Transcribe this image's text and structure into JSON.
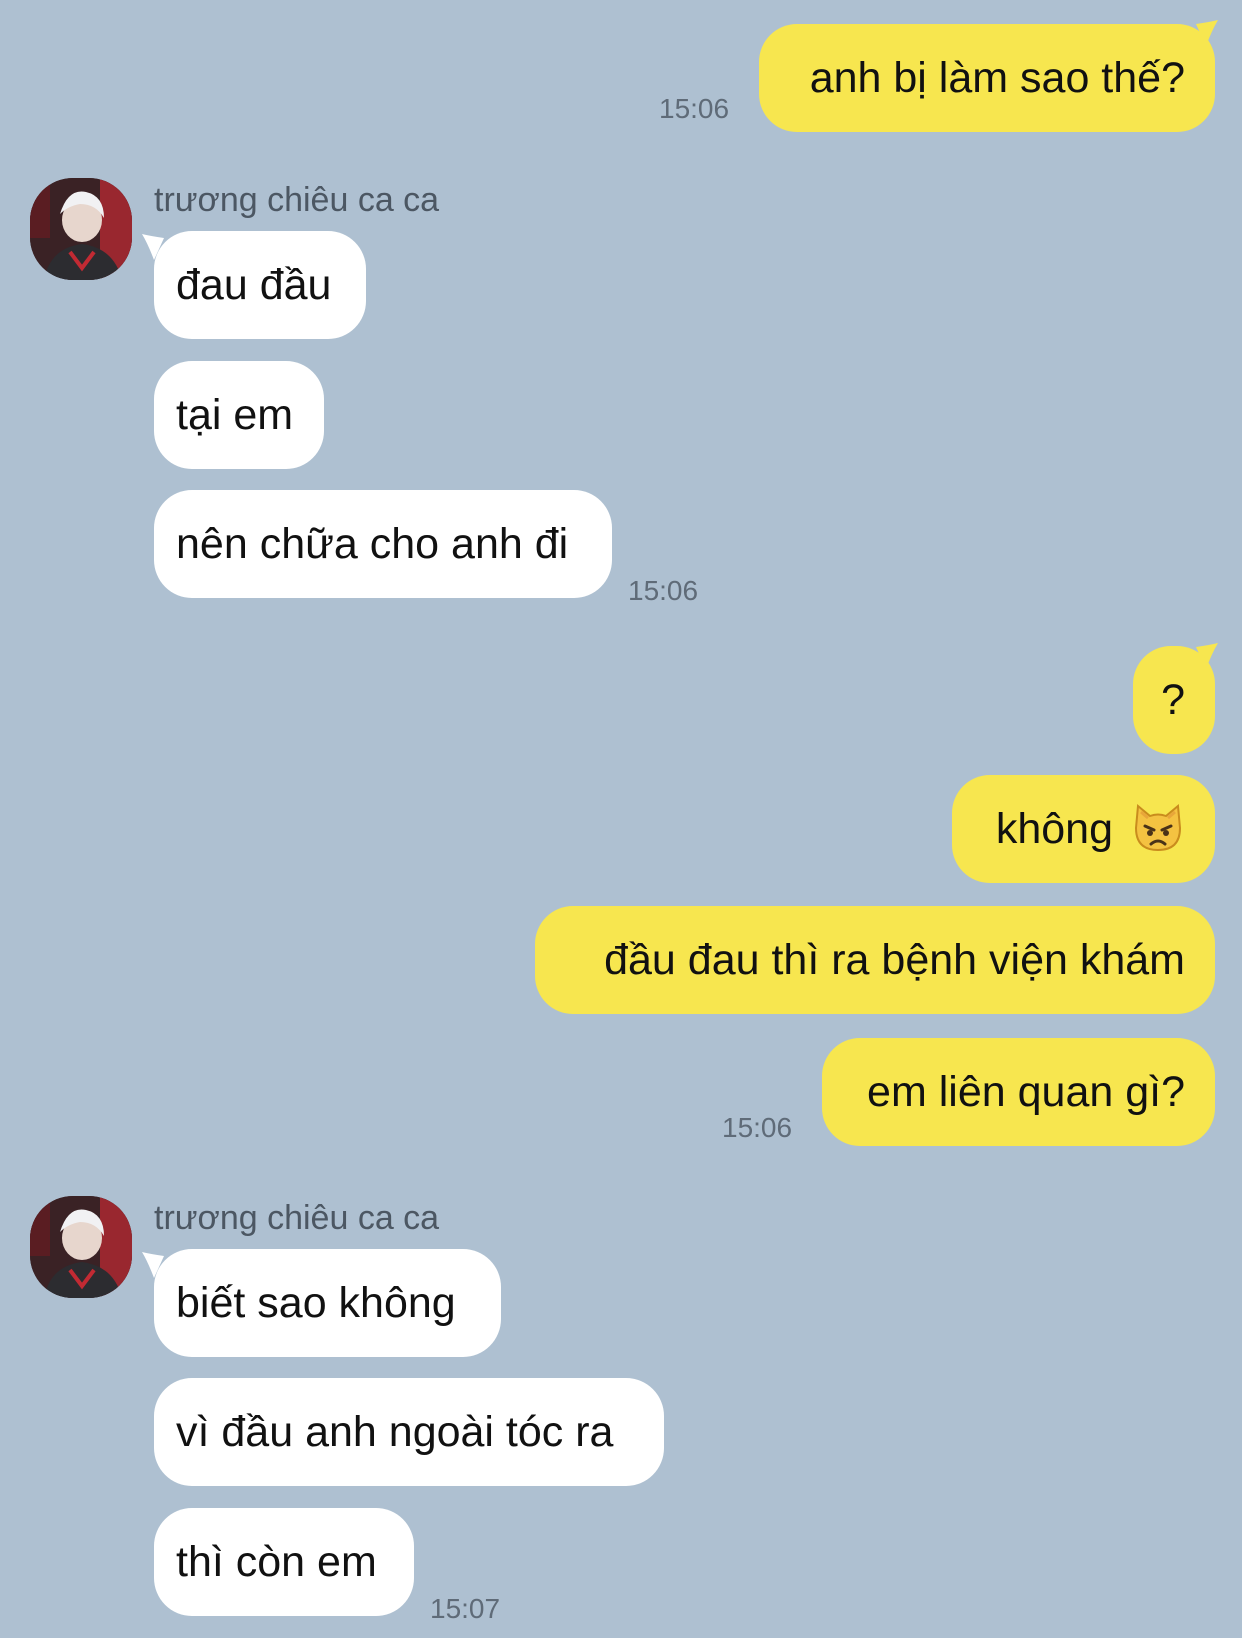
{
  "chat": {
    "sender_name": "trương chiêu ca ca",
    "avatar_icon": "avatar-photo",
    "colors": {
      "background": "#aec0d1",
      "incoming_bubble": "#ffffff",
      "outgoing_bubble": "#f7e64f"
    },
    "messages": [
      {
        "text": "anh bị làm sao thế?"
      },
      {
        "text": "đau đầu"
      },
      {
        "text": "tại em"
      },
      {
        "text": "nên chữa cho anh đi"
      },
      {
        "text": "?"
      },
      {
        "text": "không",
        "emoji": "angry-cat-emoji"
      },
      {
        "text": "đầu đau thì ra bệnh viện khám"
      },
      {
        "text": "em liên quan gì?"
      },
      {
        "text": "biết sao không"
      },
      {
        "text": "vì đầu anh ngoài tóc ra"
      },
      {
        "text": "thì còn em"
      }
    ],
    "timestamps": [
      "15:06",
      "15:06",
      "15:06",
      "15:07"
    ]
  }
}
